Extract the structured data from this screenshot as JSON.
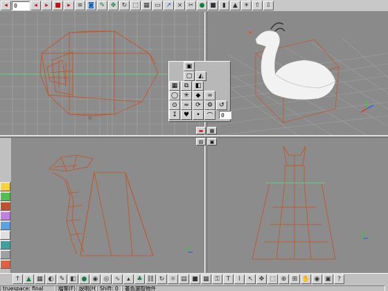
{
  "toolbar": {
    "frame_value": "0",
    "icons": [
      "play-first-icon",
      "play-reverse-icon",
      "play-icon",
      "stop-icon",
      "play-last-icon",
      "list-icon",
      "camera-icon",
      "color-icon",
      "move-icon",
      "rotate-icon",
      "scale-icon",
      "grid-icon",
      "object-icon",
      "select-icon",
      "link-icon",
      "unlink-icon",
      "sphere-icon",
      "cube-icon",
      "cylinder-icon",
      "cone-icon",
      "light-icon",
      "undo-icon",
      "redo-icon"
    ]
  },
  "float_panel": {
    "value": "0",
    "arrows_label": "▸◂"
  },
  "status": {
    "title": "truespace: final",
    "left_cells": [
      "檔案(F)",
      "說明(H)"
    ],
    "shift_label": "Shift: 0",
    "message": "著色選取物件"
  },
  "colors": {
    "wire": "#c8501e",
    "wire_light": "#e0b040",
    "grid": "#a6a6a6",
    "grid_axis": "#60d080",
    "viewport_bg": "#8c8c8c",
    "perspective_bg": "#8a8a8a"
  }
}
